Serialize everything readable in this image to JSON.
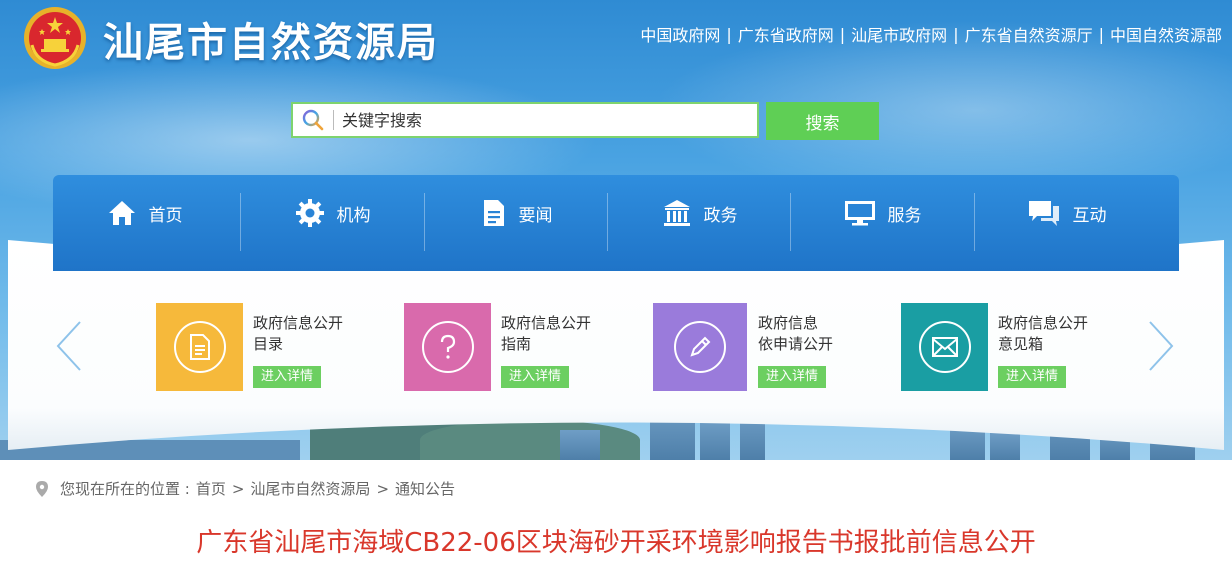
{
  "header": {
    "site_title": "汕尾市自然资源局",
    "top_links": [
      "中国政府网",
      "广东省政府网",
      "汕尾市政府网",
      "广东省自然资源厅",
      "中国自然资源部"
    ],
    "separator": "|"
  },
  "search": {
    "placeholder": "关键字搜索",
    "button_label": "搜索"
  },
  "nav": {
    "items": [
      {
        "label": "首页",
        "icon": "home-icon"
      },
      {
        "label": "机构",
        "icon": "gear-icon"
      },
      {
        "label": "要闻",
        "icon": "document-icon"
      },
      {
        "label": "政务",
        "icon": "government-building-icon"
      },
      {
        "label": "服务",
        "icon": "monitor-icon"
      },
      {
        "label": "互动",
        "icon": "chat-icon"
      }
    ]
  },
  "cards": [
    {
      "line1": "政府信息公开",
      "line2": "目录",
      "button": "进入详情",
      "color": "#f6b93b",
      "icon": "file-list-icon"
    },
    {
      "line1": "政府信息公开",
      "line2": "指南",
      "button": "进入详情",
      "color": "#d96aac",
      "icon": "question-icon"
    },
    {
      "line1": "政府信息",
      "line2": "依申请公开",
      "button": "进入详情",
      "color": "#9a7bdb",
      "icon": "pen-icon"
    },
    {
      "line1": "政府信息公开",
      "line2": "意见箱",
      "button": "进入详情",
      "color": "#1a9ea3",
      "icon": "envelope-icon"
    }
  ],
  "breadcrumb": {
    "prefix": "您现在所在的位置 :",
    "items": [
      "首页",
      "汕尾市自然资源局",
      "通知公告"
    ],
    "separator": ">"
  },
  "article": {
    "title": "广东省汕尾市海域CB22-06区块海砂开采环境影响报告书报批前信息公开"
  },
  "colors": {
    "nav_blue": "#1f74c8",
    "search_green": "#5fcf55",
    "title_red": "#d9372b"
  }
}
